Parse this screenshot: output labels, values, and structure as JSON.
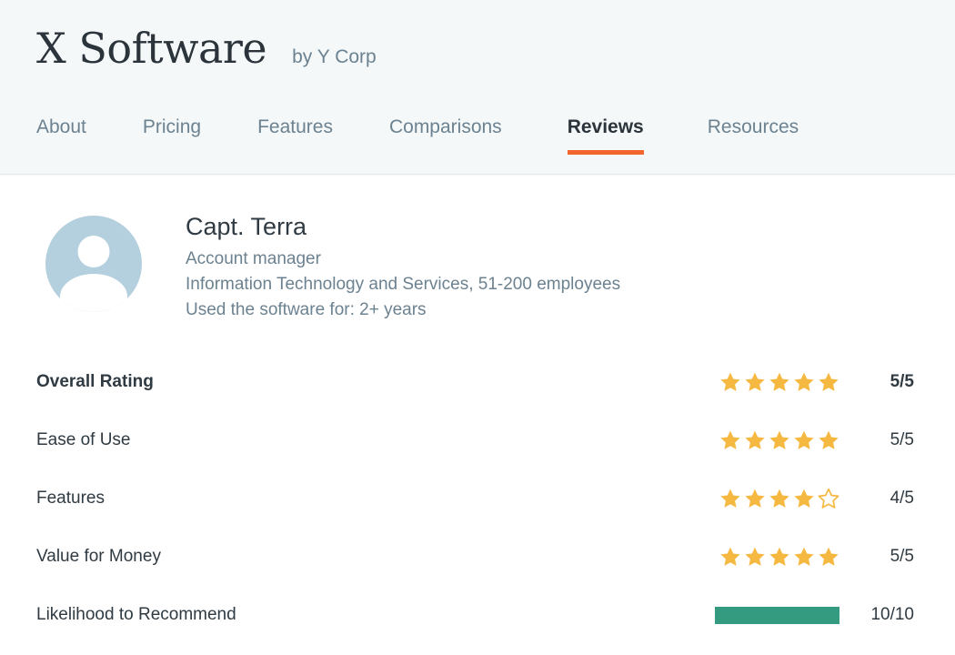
{
  "header": {
    "product_title": "X Software",
    "vendor": "by Y Corp"
  },
  "nav": {
    "items": [
      {
        "label": "About",
        "active": false
      },
      {
        "label": "Pricing",
        "active": false
      },
      {
        "label": "Features",
        "active": false
      },
      {
        "label": "Comparisons",
        "active": false
      },
      {
        "label": "Reviews",
        "active": true
      },
      {
        "label": "Resources",
        "active": false
      }
    ],
    "active_indicator_color": "#f26730"
  },
  "reviewer": {
    "name": "Capt. Terra",
    "job_title": "Account manager",
    "industry_size": "Information Technology and Services, 51-200 employees",
    "usage_duration": "Used the software for: 2+ years",
    "avatar_icon": "user-avatar-icon",
    "avatar_color": "#b4cfdd"
  },
  "ratings": {
    "star_color": "#f5b942",
    "bar_color": "#349a80",
    "rows": [
      {
        "label": "Overall Rating",
        "type": "stars",
        "filled": 5,
        "total": 5,
        "value": "5/5",
        "emphasis": true
      },
      {
        "label": "Ease of Use",
        "type": "stars",
        "filled": 5,
        "total": 5,
        "value": "5/5",
        "emphasis": false
      },
      {
        "label": "Features",
        "type": "stars",
        "filled": 4,
        "total": 5,
        "value": "4/5",
        "emphasis": false
      },
      {
        "label": "Value for Money",
        "type": "stars",
        "filled": 5,
        "total": 5,
        "value": "5/5",
        "emphasis": false
      },
      {
        "label": "Likelihood to Recommend",
        "type": "bar",
        "filled": 10,
        "total": 10,
        "value": "10/10",
        "emphasis": false
      }
    ]
  }
}
